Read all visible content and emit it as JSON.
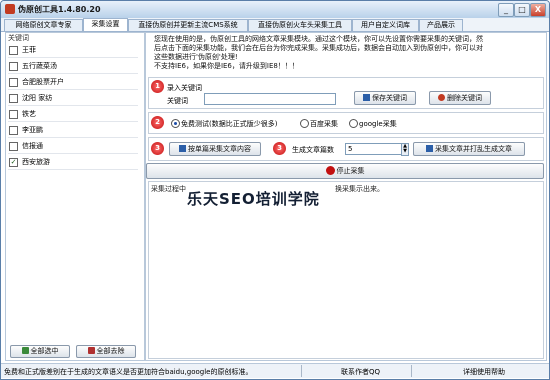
{
  "window": {
    "title": "伪原创工具1.4.80.20",
    "controls": {
      "minimize": "_",
      "maximize": "□",
      "close": "X"
    }
  },
  "tabs": [
    {
      "label": "网络原创文章专家",
      "active": false
    },
    {
      "label": "采集设置",
      "active": true
    },
    {
      "label": "直接伪原创并更新主流CMS系统",
      "active": false
    },
    {
      "label": "直接伪原创火车头采集工具",
      "active": false
    },
    {
      "label": "用户自定义词库",
      "active": false
    },
    {
      "label": "产品展示",
      "active": false
    }
  ],
  "keywords": {
    "header": "关键词",
    "items": [
      {
        "label": "王菲",
        "checked": false
      },
      {
        "label": "五行蔬菜汤",
        "checked": false
      },
      {
        "label": "合肥股票开户",
        "checked": false
      },
      {
        "label": "沈阳 家纺",
        "checked": false
      },
      {
        "label": "铁艺",
        "checked": false
      },
      {
        "label": "李亚鹏",
        "checked": false
      },
      {
        "label": "信报通",
        "checked": false
      },
      {
        "label": "西安旅游",
        "checked": true
      }
    ],
    "select_all": "全部选中",
    "remove_all": "全部去除"
  },
  "description": {
    "text": "您现在使用的是，伪原创工具的网络文章采集模块。通过这个模块，你可以先设置你需要采集的关键词，然后点击下面的采集功能，我们会在后台为你完成采集。采集成功后，数据会自动加入到伪原创中，你可以对这些数据进行'伪原创'处理!",
    "warning": "不支持IE6，如果你是IE6，请升级到IE8！！！"
  },
  "step1": {
    "badge": "1",
    "title": "录入关键词",
    "field_label": "关键词",
    "field_value": "",
    "save_label": "保存关键词",
    "delete_label": "删除关键词"
  },
  "step2": {
    "badge": "2",
    "options": [
      {
        "label": "免费测试(数据比正式版少很多)",
        "selected": true
      },
      {
        "label": "百度采集",
        "selected": false
      },
      {
        "label": "google采集",
        "selected": false
      }
    ]
  },
  "step3": {
    "badge": "3",
    "collect_single": "按单篇采集文章内容",
    "badge2": "3",
    "count_label": "生成文章篇数",
    "count_value": "5",
    "collect_batch": "采集文章并打乱生成文章"
  },
  "stop": {
    "label": "停止采集"
  },
  "log": {
    "line_left": "采集过程中",
    "line_right": "换采集示出来。",
    "watermark": "乐天SEO培训学院"
  },
  "statusbar": {
    "notice": "免费和正式版差别在于生成的文章语义是否更加符合baidu,google的原创标准。",
    "contact": "联系作者QQ",
    "help": "详细使用帮助"
  },
  "colors": {
    "accent": "#c21010",
    "title_gradient_top": "#e8f1fb",
    "title_gradient_bottom": "#b9d1ea",
    "tab_active": "#ffffff",
    "check_green": "#1a5c1a"
  }
}
